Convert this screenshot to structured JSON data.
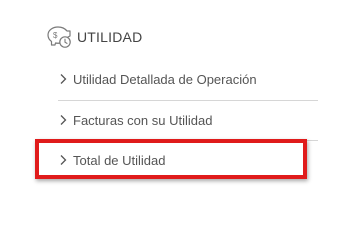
{
  "menu": {
    "header": {
      "label": "UTILIDAD",
      "icon": "piggy-bank-dollar-clock-icon"
    },
    "items": [
      {
        "label": "Utilidad Detallada de Operación",
        "icon": "chevron-right-icon"
      },
      {
        "label": "Facturas con su Utilidad",
        "icon": "chevron-right-icon"
      },
      {
        "label": "Total de Utilidad",
        "icon": "chevron-right-icon",
        "highlighted": true
      }
    ]
  },
  "colors": {
    "text": "#555555",
    "divider": "#d6d6d6",
    "highlight": "#e01b1b"
  }
}
